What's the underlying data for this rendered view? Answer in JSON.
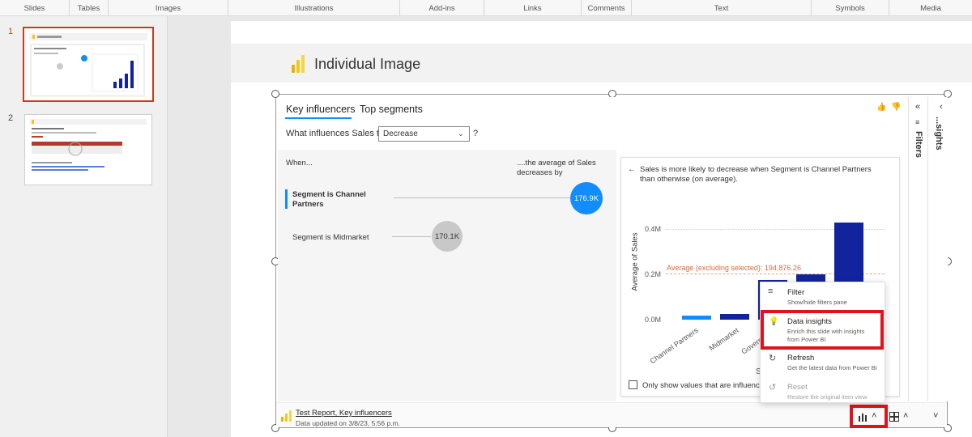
{
  "ribbon": {
    "groups": [
      "Slides",
      "Tables",
      "Images",
      "Illustrations",
      "Add-ins",
      "Links",
      "Comments",
      "Text",
      "Symbols",
      "Media"
    ]
  },
  "thumbnails": {
    "items": [
      {
        "number": "1",
        "selected": true
      },
      {
        "number": "2",
        "selected": false
      }
    ]
  },
  "slide": {
    "title": "Individual Image"
  },
  "visual": {
    "tabs": [
      "Key influencers",
      "Top segments"
    ],
    "question_label": "What influences Sales to",
    "dropdown_value": "Decrease",
    "question_mark": "?",
    "when_label": "When...",
    "avg_header": "....the average of Sales decreases by",
    "influencers": [
      {
        "label": "Segment is Channel Partners",
        "value": "176.9K"
      },
      {
        "label": "Segment is Midmarket",
        "value": "170.1K"
      }
    ],
    "card_back": "←",
    "card_title": "Sales is more likely to decrease when Segment is Channel Partners than otherwise (on average).",
    "checkbox_label": "Only show values that are influencers",
    "thumb_up": "👍",
    "thumb_down": "👎"
  },
  "chart_data": {
    "type": "bar",
    "title": "",
    "ylabel": "Average of Sales",
    "xlabel": "S",
    "ylim": [
      0,
      0.45
    ],
    "yticks": [
      "0.4M",
      "0.2M",
      "0.0M"
    ],
    "categories": [
      "Channel Partners",
      "Midmarket",
      "Government",
      "",
      ""
    ],
    "values": [
      0.018,
      0.025,
      0.175,
      0.2,
      0.43
    ],
    "colors": [
      "#118dff",
      "#12239e",
      "#12239e",
      "#12239e",
      "#12239e"
    ],
    "average_label": "Average (excluding selected): 194,876.26",
    "average_value": 0.195
  },
  "panes": {
    "filters": "Filters",
    "insights": "...sights"
  },
  "footer": {
    "title": "Test Report, Key influencers",
    "subtitle": "Data updated on 3/8/23, 5:56 p.m."
  },
  "menu": {
    "items": [
      {
        "title": "Filter",
        "subtitle": "Show/hide filters pane",
        "icon": "≡"
      },
      {
        "title": "Data insights",
        "subtitle": "Enrich this slide with insights from Power BI",
        "icon": "💡"
      },
      {
        "title": "Refresh",
        "subtitle": "Get the latest data from Power BI",
        "icon": "↻"
      },
      {
        "title": "Reset",
        "subtitle": "Restore the original item view",
        "icon": "↺"
      }
    ]
  },
  "colors": {
    "accent": "#118dff",
    "bar_dark": "#12239e",
    "highlight_red": "#e0131a",
    "powerbi_yellow": "#f2c811",
    "slide_select": "#c43e1c"
  }
}
